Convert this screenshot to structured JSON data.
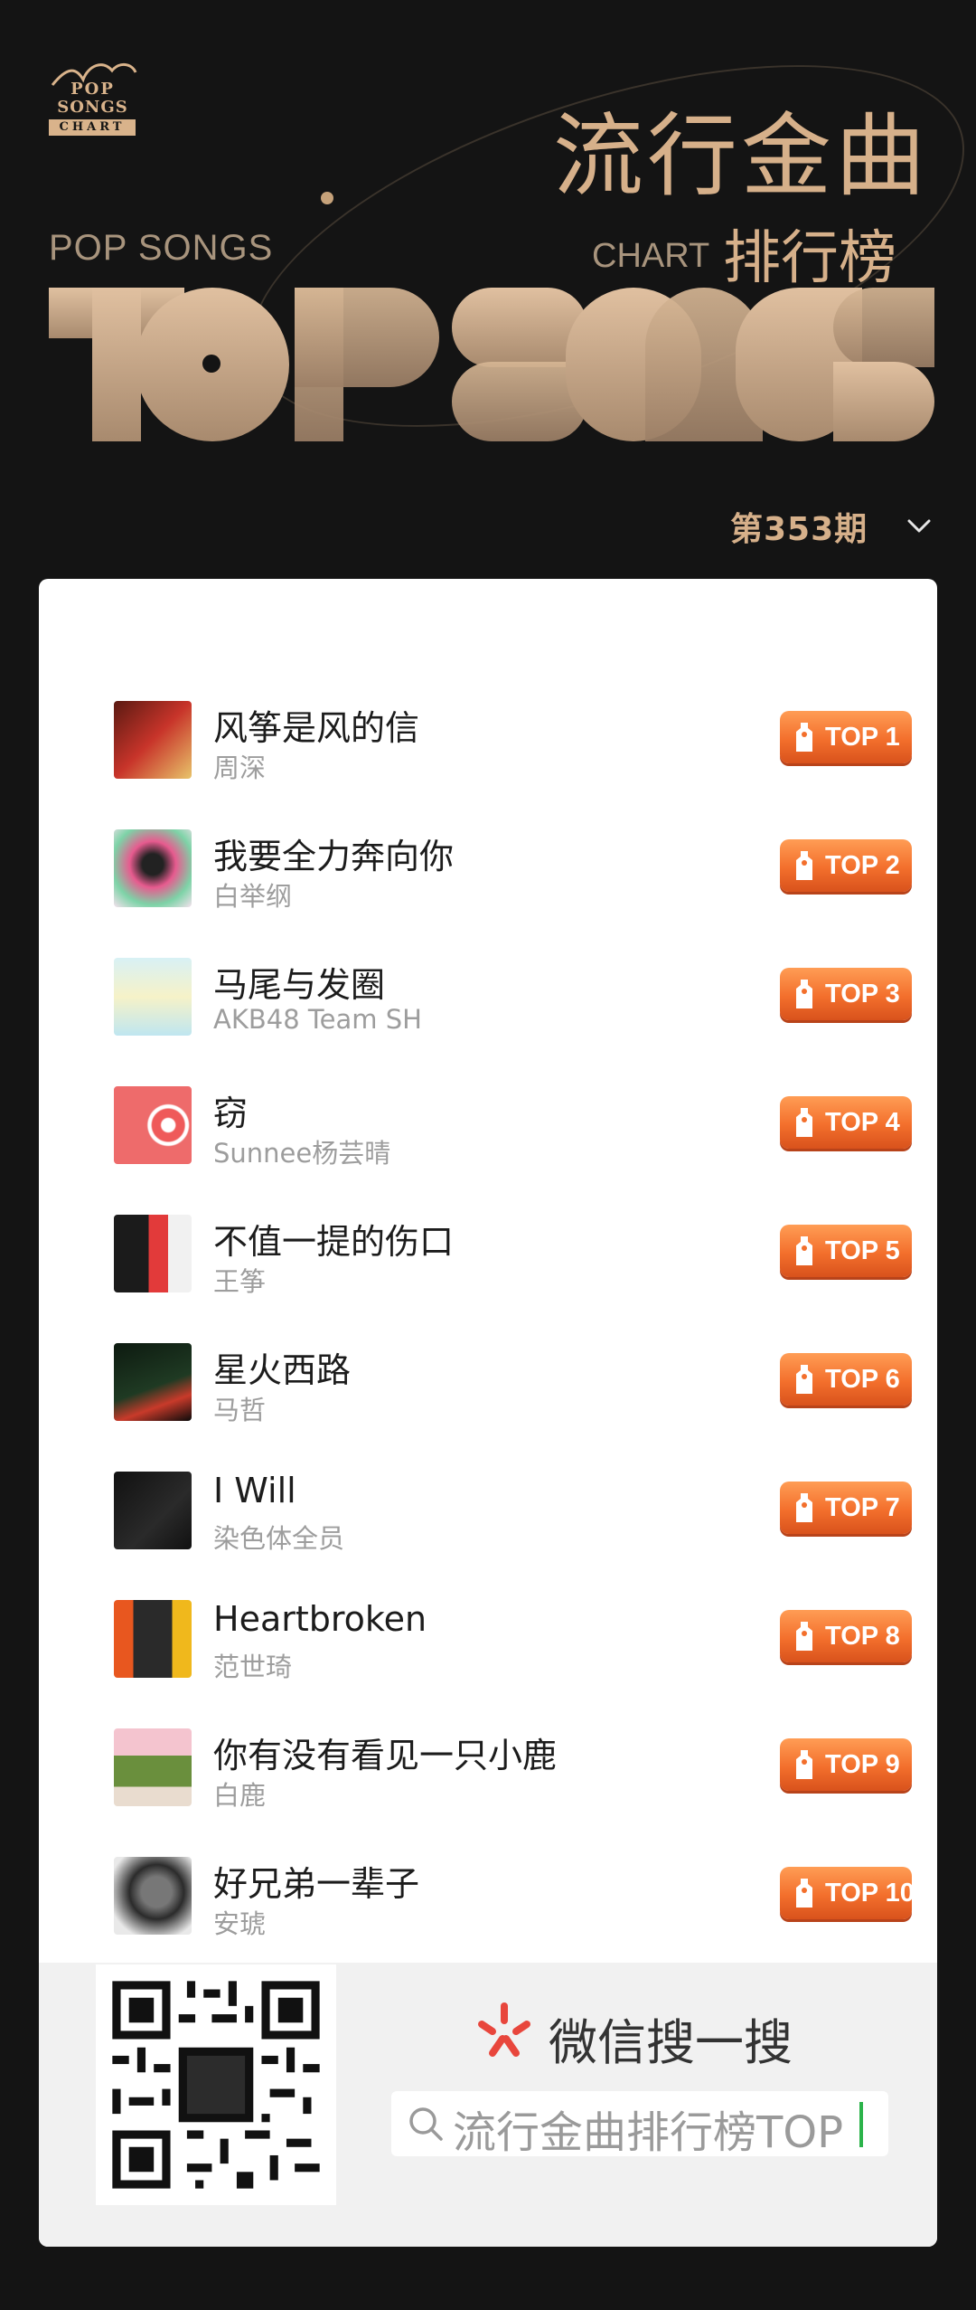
{
  "header": {
    "logo": {
      "pop": "POP",
      "songs": "SONGS",
      "chart": "CHART"
    },
    "title_cn": "流行金曲",
    "subtitle_cn": "排行榜",
    "label_pop_songs": "POP SONGS",
    "label_chart": "CHART",
    "graphic_text": "TOP SONGS",
    "issue": "第353期",
    "accent_color": "#d6b08a"
  },
  "songs": [
    {
      "title": "风筝是风的信",
      "artist": "周深",
      "badge": "TOP 1"
    },
    {
      "title": "我要全力奔向你",
      "artist": "白举纲",
      "badge": "TOP 2"
    },
    {
      "title": "马尾与发圈",
      "artist": "AKB48 Team SH",
      "badge": "TOP 3"
    },
    {
      "title": "窃",
      "artist": "Sunnee杨芸晴",
      "badge": "TOP 4"
    },
    {
      "title": "不值一提的伤口",
      "artist": "王筝",
      "badge": "TOP 5"
    },
    {
      "title": "星火西路",
      "artist": "马哲",
      "badge": "TOP 6"
    },
    {
      "title": " I Will",
      "artist": "染色体全员",
      "badge": "TOP 7"
    },
    {
      "title": "Heartbroken",
      "artist": "范世琦",
      "badge": "TOP 8"
    },
    {
      "title": "你有没有看见一只小鹿",
      "artist": "白鹿",
      "badge": "TOP 9"
    },
    {
      "title": "好兄弟一辈子",
      "artist": "安琥",
      "badge": "TOP 10"
    }
  ],
  "footer": {
    "wechat_search_label": "微信搜一搜",
    "search_query": "流行金曲排行榜TOP"
  }
}
